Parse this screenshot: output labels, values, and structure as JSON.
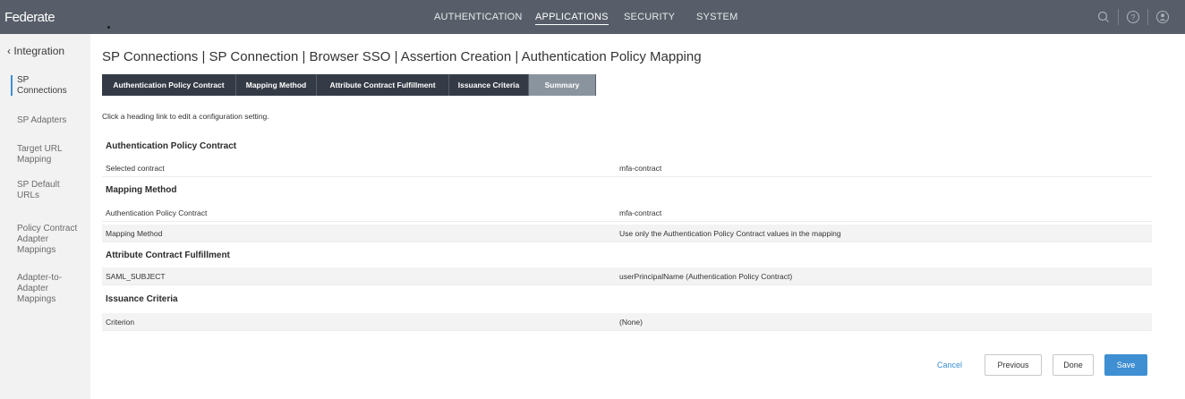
{
  "app": {
    "brand": "Federate"
  },
  "topnav": {
    "items": [
      {
        "label": "AUTHENTICATION"
      },
      {
        "label": "APPLICATIONS"
      },
      {
        "label": "SECURITY"
      },
      {
        "label": "SYSTEM"
      }
    ],
    "active": "APPLICATIONS",
    "icons": [
      "search-icon",
      "help-icon",
      "user-icon"
    ]
  },
  "sidebar": {
    "back_label": "Integration",
    "items": [
      {
        "label": "SP Connections"
      },
      {
        "label": "SP Adapters"
      },
      {
        "label": "Target URL Mapping"
      },
      {
        "label": "SP Default URLs"
      },
      {
        "label": "Policy Contract Adapter Mappings"
      },
      {
        "label": "Adapter-to-Adapter Mappings"
      }
    ]
  },
  "page": {
    "title": "SP Connections | SP Connection | Browser SSO | Assertion Creation | Authentication Policy Mapping",
    "hint": "Click a heading link to edit a configuration setting."
  },
  "tabs": [
    {
      "label": "Authentication Policy Contract"
    },
    {
      "label": "Mapping Method"
    },
    {
      "label": "Attribute Contract Fulfillment"
    },
    {
      "label": "Issuance Criteria"
    },
    {
      "label": "Summary"
    }
  ],
  "summary": [
    {
      "heading": "Authentication Policy Contract",
      "rows": [
        {
          "label": "Selected contract",
          "value": "mfa-contract"
        }
      ]
    },
    {
      "heading": "Mapping Method",
      "rows": [
        {
          "label": "Authentication Policy Contract",
          "value": "mfa-contract"
        },
        {
          "label": "Mapping Method",
          "value": "Use only the Authentication Policy Contract values in the mapping"
        }
      ]
    },
    {
      "heading": "Attribute Contract Fulfillment",
      "rows": [
        {
          "label": "SAML_SUBJECT",
          "value": "userPrincipalName (Authentication Policy Contract)"
        }
      ]
    },
    {
      "heading": "Issuance Criteria",
      "rows": [
        {
          "label": "Criterion",
          "value": "(None)"
        }
      ]
    }
  ],
  "footer": {
    "cancel": "Cancel",
    "previous": "Previous",
    "done": "Done",
    "save": "Save"
  },
  "colors": {
    "topbar": "#575e69",
    "tab_dark": "#353b46",
    "tab_active": "#8a949f",
    "accent": "#3f8fd2"
  }
}
